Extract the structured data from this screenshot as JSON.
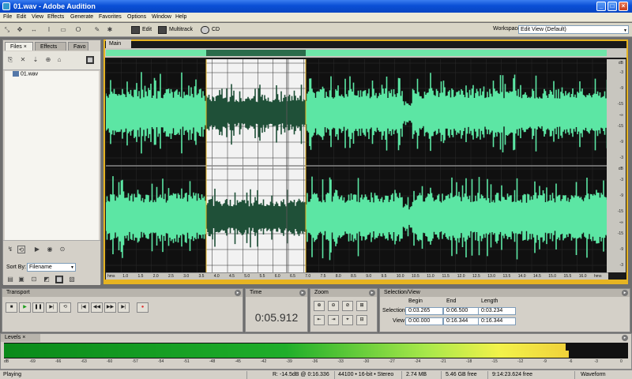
{
  "window": {
    "title": "01.wav - Adobe Audition"
  },
  "menu": [
    "File",
    "Edit",
    "View",
    "Effects",
    "Generate",
    "Favorites",
    "Options",
    "Window",
    "Help"
  ],
  "toolbar": {
    "edit_label": "Edit",
    "multitrack_label": "Multitrack",
    "cd_label": "CD",
    "workspace_label": "Workspace:",
    "workspace_value": "Edit View (Default)"
  },
  "left_panel": {
    "tabs": [
      "Files",
      "Effects",
      "Favo"
    ],
    "files": [
      "01.wav"
    ],
    "sort_label": "Sort By:",
    "sort_value": "Filename"
  },
  "main": {
    "tab_label": "Main",
    "scale_labels": [
      "dB",
      "-3",
      "-9",
      "-15",
      "-∞",
      "-15",
      "-9",
      "-3",
      "dB",
      "-3",
      "-9",
      "-15",
      "-∞",
      "-15",
      "-9",
      "-3"
    ],
    "ruler_labels": [
      "hms",
      "1.0",
      "1.5",
      "2.0",
      "2.5",
      "3.0",
      "3.5",
      "4.0",
      "4.5",
      "5.0",
      "5.5",
      "6.0",
      "6.5",
      "7.0",
      "7.5",
      "8.0",
      "8.5",
      "9.0",
      "9.5",
      "10.0",
      "10.5",
      "11.0",
      "11.5",
      "12.0",
      "12.5",
      "13.0",
      "13.5",
      "14.0",
      "14.5",
      "15.0",
      "15.5",
      "16.0",
      "hms"
    ]
  },
  "transport": {
    "title": "Transport"
  },
  "time": {
    "title": "Time",
    "display": "0:05.912"
  },
  "zoom": {
    "title": "Zoom"
  },
  "selection_view": {
    "title": "Selection/View",
    "col_begin": "Begin",
    "col_end": "End",
    "col_length": "Length",
    "row_selection": "Selection",
    "row_view": "View",
    "selection": {
      "begin": "0:03.265",
      "end": "0:06.500",
      "length": "0:03.234"
    },
    "view": {
      "begin": "0:00.000",
      "end": "0:16.344",
      "length": "0:16.344"
    }
  },
  "levels": {
    "title": "Levels",
    "scale": [
      "dB",
      "-69",
      "-66",
      "-63",
      "-60",
      "-57",
      "-54",
      "-51",
      "-48",
      "-45",
      "-42",
      "-39",
      "-36",
      "-33",
      "-30",
      "-27",
      "-24",
      "-21",
      "-18",
      "-15",
      "-12",
      "-9",
      "-6",
      "-3",
      "0"
    ],
    "left_level": 0.9,
    "right_level": 0.905
  },
  "status": {
    "state": "Playing",
    "levels": "R: -14.5dB @  0:16.336",
    "format": "44100 • 16-bit • Stereo",
    "size": "2.74 MB",
    "free": "5.46 GB free",
    "free_time": "9:14:23.624 free",
    "view_mode": "Waveform"
  },
  "colors": {
    "waveform": "#5ce6a4",
    "waveform_selected": "#1f5038",
    "selection_bg": "#f2f2f2",
    "accent": "#e6b422"
  }
}
